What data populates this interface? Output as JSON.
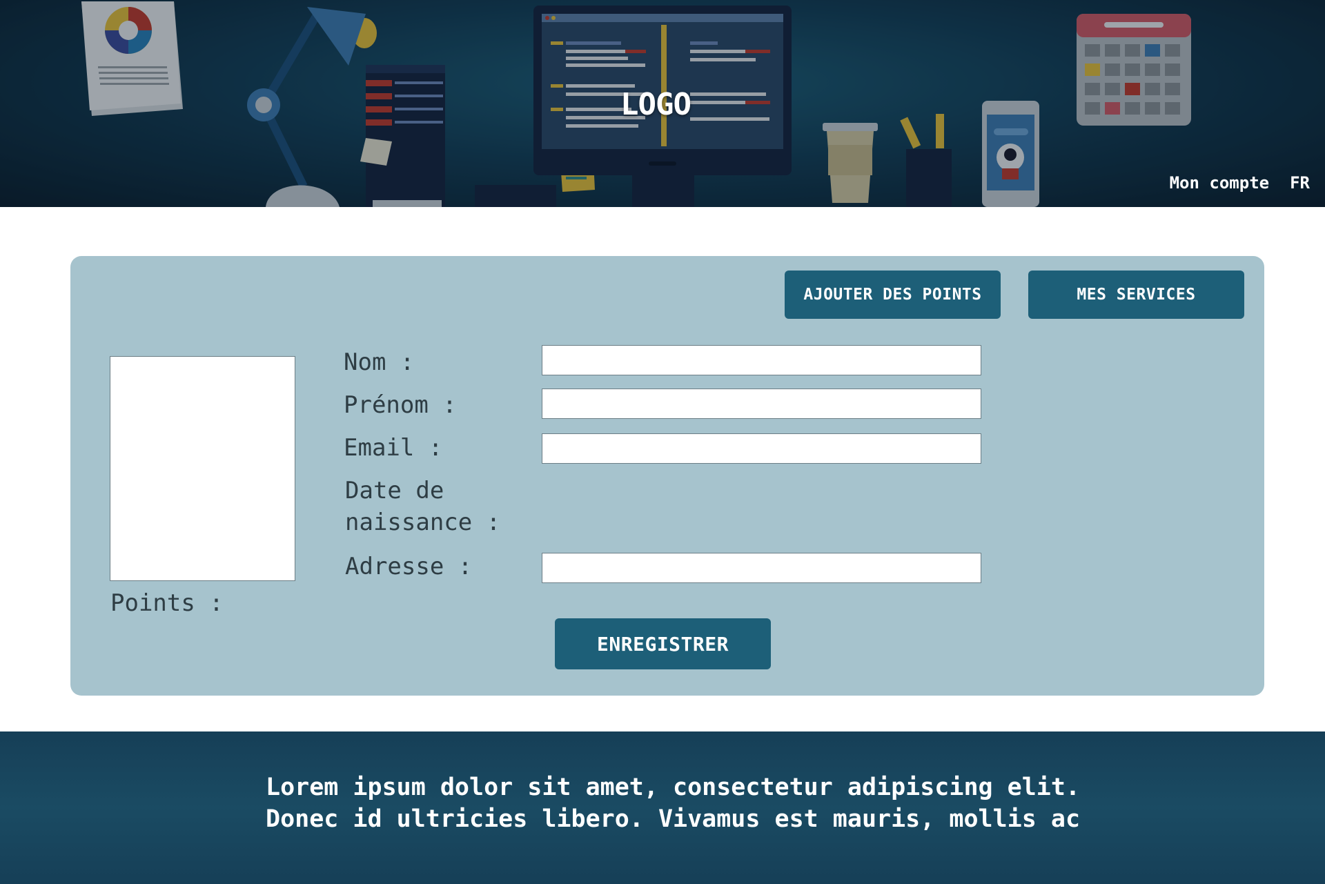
{
  "header": {
    "logo_text": "LOGO",
    "nav": {
      "account_label": "Mon compte",
      "language_label": "FR"
    }
  },
  "profile_card": {
    "add_points_label": "AJOUTER DES POINTS",
    "services_label": "MES SERVICES",
    "points_label": "Points :",
    "fields": {
      "nom": {
        "label": "Nom :",
        "value": ""
      },
      "prenom": {
        "label": "Prénom :",
        "value": ""
      },
      "email": {
        "label": "Email :",
        "value": ""
      },
      "date_naissance": {
        "label": "Date de\nnaissance :"
      },
      "adresse": {
        "label": "Adresse :",
        "value": ""
      }
    },
    "save_label": "ENREGISTRER"
  },
  "footer": {
    "text": "Lorem ipsum dolor sit amet, consectetur adipiscing elit.\nDonec id ultricies libero. Vivamus est mauris, mollis ac"
  },
  "colors": {
    "header_dark": "#0a1c2a",
    "header_teal": "#1d5f78",
    "card_background": "#a6c3cd",
    "button": "#1d5f78",
    "footer": "#163f57"
  }
}
